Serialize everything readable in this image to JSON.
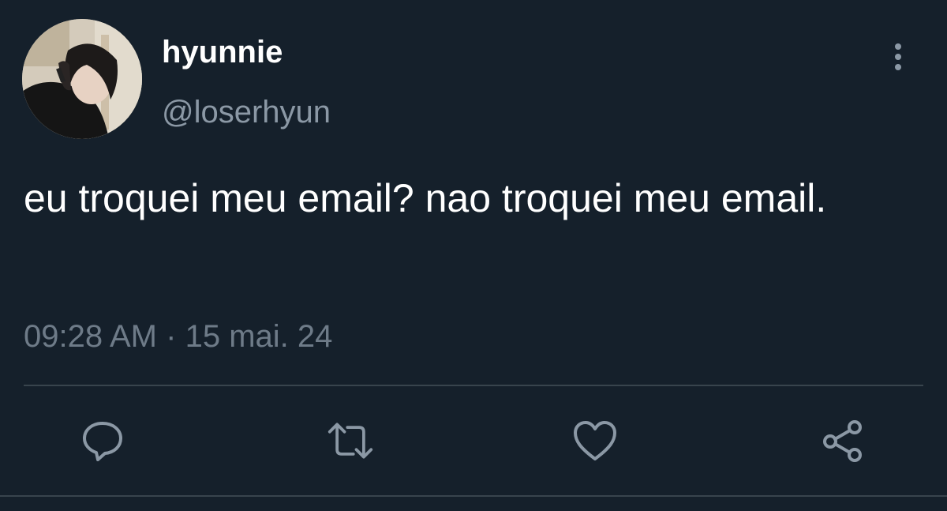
{
  "tweet": {
    "display_name": "hyunnie",
    "handle": "@loserhyun",
    "text": "eu troquei meu email? nao troquei meu email.",
    "time": "09:28 AM",
    "separator": "·",
    "date": "15 mai. 24"
  },
  "icons": {
    "more": "more-vertical-icon",
    "reply": "reply-icon",
    "retweet": "retweet-icon",
    "like": "heart-icon",
    "share": "share-icon"
  },
  "colors": {
    "background": "#15202b",
    "primary_text": "#ffffff",
    "secondary_text": "#8b98a5",
    "icon": "#8b98a5",
    "divider": "#38444d"
  }
}
